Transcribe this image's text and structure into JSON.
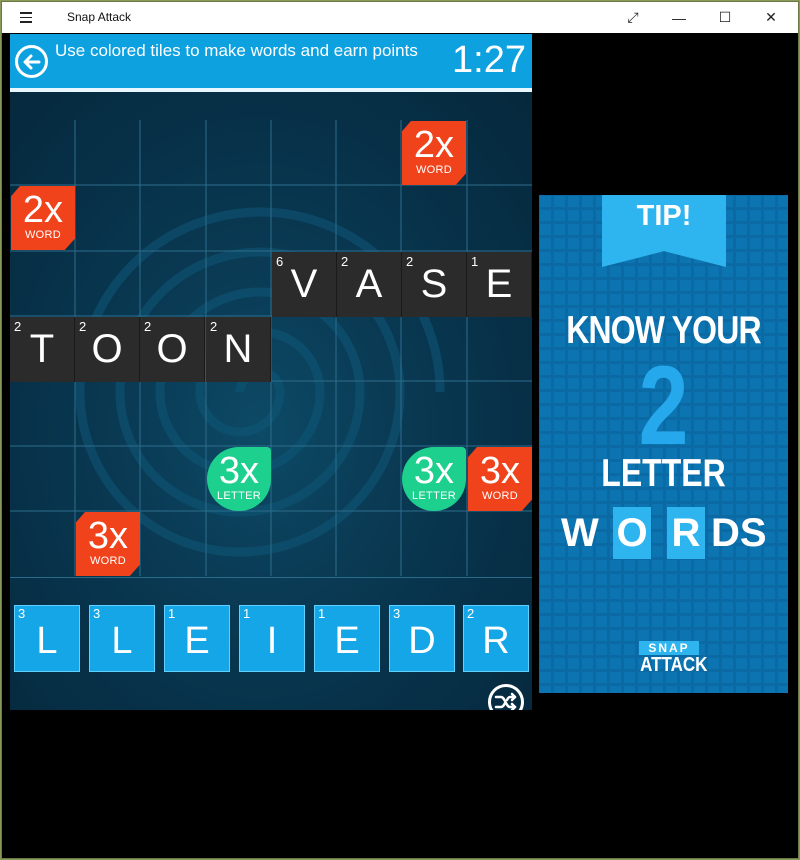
{
  "window": {
    "title": "Snap Attack",
    "buttons": {
      "expand": "⤢",
      "minimize": "—",
      "maximize": "☐",
      "close": "✕"
    }
  },
  "header": {
    "instruction": "Use colored tiles to make words and earn points",
    "timer": "1:27"
  },
  "board": {
    "word_vase": [
      {
        "letter": "V",
        "points": "6"
      },
      {
        "letter": "A",
        "points": "2"
      },
      {
        "letter": "S",
        "points": "2"
      },
      {
        "letter": "E",
        "points": "1"
      }
    ],
    "word_toon": [
      {
        "letter": "T",
        "points": "2"
      },
      {
        "letter": "O",
        "points": "2"
      },
      {
        "letter": "O",
        "points": "2"
      },
      {
        "letter": "N",
        "points": "2"
      }
    ],
    "bonuses": [
      {
        "mult": "2x",
        "kind": "WORD",
        "type": "word"
      },
      {
        "mult": "2x",
        "kind": "WORD",
        "type": "word"
      },
      {
        "mult": "3x",
        "kind": "LETTER",
        "type": "letter"
      },
      {
        "mult": "3x",
        "kind": "LETTER",
        "type": "letter"
      },
      {
        "mult": "3x",
        "kind": "WORD",
        "type": "word"
      },
      {
        "mult": "3x",
        "kind": "WORD",
        "type": "word"
      }
    ]
  },
  "rack": [
    {
      "letter": "L",
      "points": "3"
    },
    {
      "letter": "L",
      "points": "3"
    },
    {
      "letter": "E",
      "points": "1"
    },
    {
      "letter": "I",
      "points": "1"
    },
    {
      "letter": "E",
      "points": "1"
    },
    {
      "letter": "D",
      "points": "3"
    },
    {
      "letter": "R",
      "points": "2"
    }
  ],
  "ad": {
    "tip": "TIP!",
    "line1": "KNOW YOUR",
    "number": "2",
    "line3": "LETTER",
    "words": [
      "W",
      "O",
      "R",
      "DS"
    ],
    "logo_top": "SNAP",
    "logo_bottom": "ATTACK"
  },
  "colors": {
    "accent": "#0ea1e0",
    "word_bonus": "#f0421b",
    "letter_bonus": "#1ed08e",
    "placed_tile": "#2b2b2b",
    "rack_tile": "#14a6e6"
  }
}
